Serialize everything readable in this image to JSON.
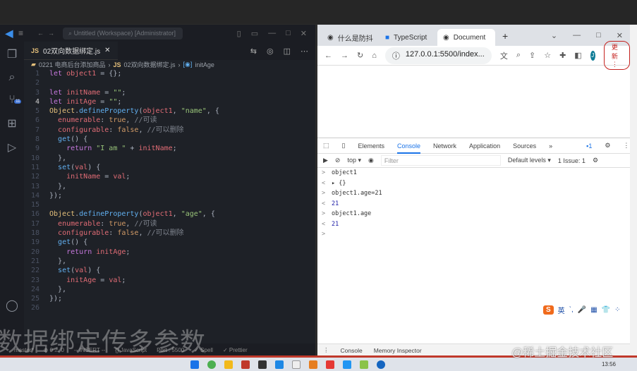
{
  "vscode": {
    "title": "Untitled (Workspace) [Administrator]",
    "tab": "02双向数据绑定.js",
    "breadcrumb": [
      "0221 电商后台添加商品",
      "02双向数据绑定.js",
      "initAge"
    ],
    "scm_badge": "11",
    "status": [
      "master*",
      "⊗ 0 ⚠ 0",
      "-- INSERT --",
      "{} JavaScript",
      "Port : 5500",
      "✓ Spell",
      "✓ Prettier"
    ]
  },
  "code": [
    [
      [
        "kw",
        "let "
      ],
      [
        "vr",
        "object1"
      ],
      [
        "pu",
        " = {};"
      ]
    ],
    [],
    [
      [
        "kw",
        "let "
      ],
      [
        "vr",
        "initName"
      ],
      [
        "pu",
        " = "
      ],
      [
        "st",
        "\"\""
      ],
      [
        "pu",
        ";"
      ]
    ],
    [
      [
        "kw",
        "let "
      ],
      [
        "vr",
        "initAge"
      ],
      [
        "pu",
        " = "
      ],
      [
        "st",
        "\"\""
      ],
      [
        "pu",
        ";"
      ]
    ],
    [
      [
        "ob",
        "Object"
      ],
      [
        "pu",
        "."
      ],
      [
        "fn",
        "defineProperty"
      ],
      [
        "pu",
        "("
      ],
      [
        "vr",
        "object1"
      ],
      [
        "pu",
        ", "
      ],
      [
        "st",
        "\"name\""
      ],
      [
        "pu",
        ", {"
      ]
    ],
    [
      [
        "pu",
        "  "
      ],
      [
        "vr",
        "enumerable"
      ],
      [
        "pu",
        ": "
      ],
      [
        "bo",
        "true"
      ],
      [
        "pu",
        ", "
      ],
      [
        "cm",
        "//可读"
      ]
    ],
    [
      [
        "pu",
        "  "
      ],
      [
        "vr",
        "configurable"
      ],
      [
        "pu",
        ": "
      ],
      [
        "bo",
        "false"
      ],
      [
        "pu",
        ", "
      ],
      [
        "cm",
        "//可以删除"
      ]
    ],
    [
      [
        "pu",
        "  "
      ],
      [
        "fn",
        "get"
      ],
      [
        "pu",
        "() {"
      ]
    ],
    [
      [
        "pu",
        "    "
      ],
      [
        "kw",
        "return "
      ],
      [
        "st",
        "\"I am \""
      ],
      [
        "pu",
        " + "
      ],
      [
        "vr",
        "initName"
      ],
      [
        "pu",
        ";"
      ]
    ],
    [
      [
        "pu",
        "  },"
      ]
    ],
    [
      [
        "pu",
        "  "
      ],
      [
        "fn",
        "set"
      ],
      [
        "pu",
        "("
      ],
      [
        "vr",
        "val"
      ],
      [
        "pu",
        ") {"
      ]
    ],
    [
      [
        "pu",
        "    "
      ],
      [
        "vr",
        "initName"
      ],
      [
        "pu",
        " = "
      ],
      [
        "vr",
        "val"
      ],
      [
        "pu",
        ";"
      ]
    ],
    [
      [
        "pu",
        "  },"
      ]
    ],
    [
      [
        "pu",
        "});"
      ]
    ],
    [],
    [
      [
        "ob",
        "Object"
      ],
      [
        "pu",
        "."
      ],
      [
        "fn",
        "defineProperty"
      ],
      [
        "pu",
        "("
      ],
      [
        "vr",
        "object1"
      ],
      [
        "pu",
        ", "
      ],
      [
        "st",
        "\"age\""
      ],
      [
        "pu",
        ", {"
      ]
    ],
    [
      [
        "pu",
        "  "
      ],
      [
        "vr",
        "enumerable"
      ],
      [
        "pu",
        ": "
      ],
      [
        "bo",
        "true"
      ],
      [
        "pu",
        ", "
      ],
      [
        "cm",
        "//可读"
      ]
    ],
    [
      [
        "pu",
        "  "
      ],
      [
        "vr",
        "configurable"
      ],
      [
        "pu",
        ": "
      ],
      [
        "bo",
        "false"
      ],
      [
        "pu",
        ", "
      ],
      [
        "cm",
        "//可以删除"
      ]
    ],
    [
      [
        "pu",
        "  "
      ],
      [
        "fn",
        "get"
      ],
      [
        "pu",
        "() {"
      ]
    ],
    [
      [
        "pu",
        "    "
      ],
      [
        "kw",
        "return "
      ],
      [
        "vr",
        "initAge"
      ],
      [
        "pu",
        ";"
      ]
    ],
    [
      [
        "pu",
        "  },"
      ]
    ],
    [
      [
        "pu",
        "  "
      ],
      [
        "fn",
        "set"
      ],
      [
        "pu",
        "("
      ],
      [
        "vr",
        "val"
      ],
      [
        "pu",
        ") {"
      ]
    ],
    [
      [
        "pu",
        "    "
      ],
      [
        "vr",
        "initAge"
      ],
      [
        "pu",
        " = "
      ],
      [
        "vr",
        "val"
      ],
      [
        "pu",
        ";"
      ]
    ],
    [
      [
        "pu",
        "  },"
      ]
    ],
    [
      [
        "pu",
        "});"
      ]
    ],
    []
  ],
  "watermark": "数据绑定传多参数",
  "browser": {
    "tabs": [
      "什么是防抖",
      "TypeScript",
      "Document"
    ],
    "url": "127.0.0.1:5500/index...",
    "avatar": "J",
    "update": "更新"
  },
  "devtools": {
    "tabs": [
      "Elements",
      "Console",
      "Network",
      "Application",
      "Sources"
    ],
    "context": "top ▾",
    "filter_placeholder": "Filter",
    "levels": "Default levels ▾",
    "issues": "1 Issue: 1",
    "msg_badge": "1",
    "console": [
      {
        "p": ">",
        "t": "object1"
      },
      {
        "p": "<",
        "t": "▸ {}"
      },
      {
        "p": ">",
        "t": "object1.age=21"
      },
      {
        "p": "<",
        "t": "21",
        "num": true
      },
      {
        "p": ">",
        "t": "object1.age"
      },
      {
        "p": "<",
        "t": "21",
        "num": true
      },
      {
        "p": ">",
        "t": ""
      }
    ],
    "drawer": [
      "Console",
      "Memory Inspector"
    ]
  },
  "ime": [
    "S",
    "英",
    "ˋ,",
    "🎤",
    "▦",
    "👕",
    "⁘"
  ],
  "credit": "@稀土掘金技术社区",
  "taskbar": {
    "time": "13:56"
  }
}
